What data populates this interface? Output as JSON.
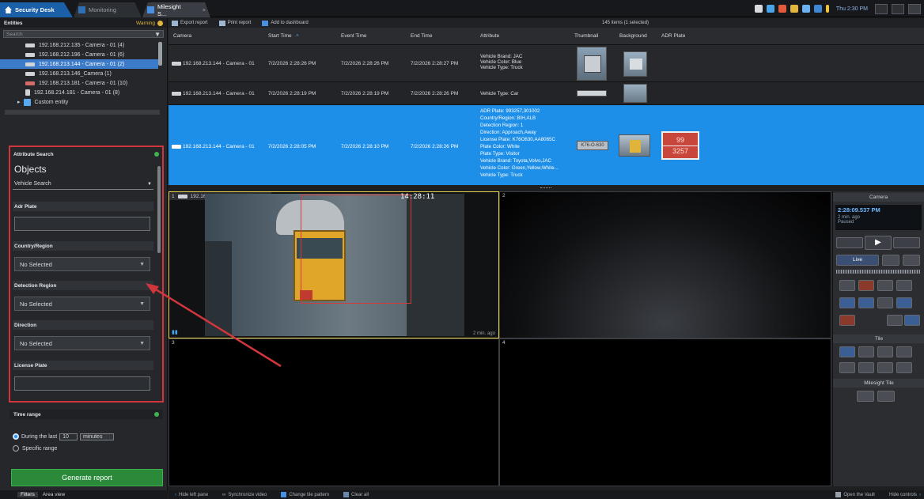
{
  "titlebar": {
    "tabs": [
      {
        "label": "Security Desk"
      },
      {
        "label": "Monitoring"
      },
      {
        "label": "Milesight S...",
        "close": "×"
      }
    ],
    "tray_time": "Thu 2:30 PM"
  },
  "left_pane": {
    "entities_label": "Entities",
    "warning_label": "Warning",
    "search_placeholder": "Search",
    "tree": [
      {
        "label": "192.168.212.135 - Camera - 01 (4)",
        "selected": false
      },
      {
        "label": "192.168.212.196 - Camera - 01 (6)",
        "selected": false
      },
      {
        "label": "192.168.213.144 - Camera - 01 (2)",
        "selected": true
      },
      {
        "label": "192.168.213.146_Camera (1)",
        "selected": false
      },
      {
        "label": "192.168.213.181 - Camera - 01 (10)",
        "selected": false
      },
      {
        "label": "192.168.214.181 - Camera - 01 (8)",
        "selected": false
      },
      {
        "label": "Custom entity",
        "selected": false
      }
    ],
    "attribute_search": {
      "header": "Attribute Search",
      "objects_label": "Objects",
      "object_type": "Vehicle Search",
      "fields": {
        "adr_plate": {
          "label": "Adr Plate",
          "value": ""
        },
        "country_region": {
          "label": "Country/Region",
          "value": "No Selected"
        },
        "detection_region": {
          "label": "Detection Region",
          "value": "No Selected"
        },
        "direction": {
          "label": "Direction",
          "value": "No Selected"
        },
        "license_plate": {
          "label": "License Plate",
          "value": ""
        }
      }
    },
    "time_range": {
      "header": "Time range",
      "during_label": "During the last",
      "amount": "10",
      "unit": "minutes",
      "specific_label": "Specific range"
    },
    "generate_button": "Generate report",
    "bottom_tabs": [
      "Filters",
      "Area view"
    ]
  },
  "report": {
    "toolbar": [
      "Export report",
      "Print report",
      "Add to dashboard"
    ],
    "count": "145 items (1 selected)",
    "columns": [
      "Camera",
      "Start Time",
      "Event Time",
      "End Time",
      "Attribute",
      "Thumbnail",
      "Background",
      "ADR Plate"
    ],
    "rows": [
      {
        "camera": "192.168.213.144 - Camera - 01",
        "start": "7/2/2026 2:28:26 PM",
        "event": "7/2/2026 2:28:26 PM",
        "end": "7/2/2026 2:28:27 PM",
        "attribute": [
          "Vehicle Brand: JAC",
          "Vehicle Color: Blue",
          "Vehicle Type: Truck"
        ],
        "selected": false
      },
      {
        "camera": "192.168.213.144 - Camera - 01",
        "start": "7/2/2026 2:28:19 PM",
        "event": "7/2/2026 2:28:19 PM",
        "end": "7/2/2026 2:28:26 PM",
        "attribute": [
          "Vehicle Type: Car"
        ],
        "selected": false
      },
      {
        "camera": "192.168.213.144 - Camera - 01",
        "start": "7/2/2026 2:28:05 PM",
        "event": "7/2/2026 2:28:10 PM",
        "end": "7/2/2026 2:28:26 PM",
        "attribute": [
          "ADR Plate: 993257,301002",
          "Country/Region: BIH,ALB",
          "Detection Region: 1",
          "Direction: Approach,Away",
          "License Plate: K76O630,AA8065C",
          "Plate Color: White",
          "Plate Type: Visitor",
          "Vehicle Brand: Toyota,Volvo,JAC",
          "Vehicle Color: Green,Yellow,White...",
          "Vehicle Type: Truck"
        ],
        "plate_text": "K76-O-630",
        "adr_top": "99",
        "adr_bottom": "3257",
        "selected": true
      }
    ]
  },
  "video": {
    "tile1_label": "192.168.213.144 - Camera - 01 (2)",
    "timestamp": "14:28:11",
    "ago": "2 min. ago",
    "tile_numbers": [
      "1",
      "2",
      "3",
      "4"
    ]
  },
  "controls": {
    "camera_header": "Camera",
    "time": "2:28:09.537 PM",
    "ago": "2 min. ago",
    "paused": "Paused",
    "live_label": "Live",
    "tile_header": "Tile",
    "milesight_header": "Milesight Tile"
  },
  "statusbar": {
    "items": [
      "Hide left pane",
      "Synchronize video",
      "Change tile pattern",
      "Clear all"
    ],
    "right_items": [
      "Open the Vault",
      "Hide controls"
    ]
  },
  "colors": {
    "accent": "#1e8fe8",
    "highlight_box": "#d0363c",
    "generate": "#2a8a3a"
  }
}
